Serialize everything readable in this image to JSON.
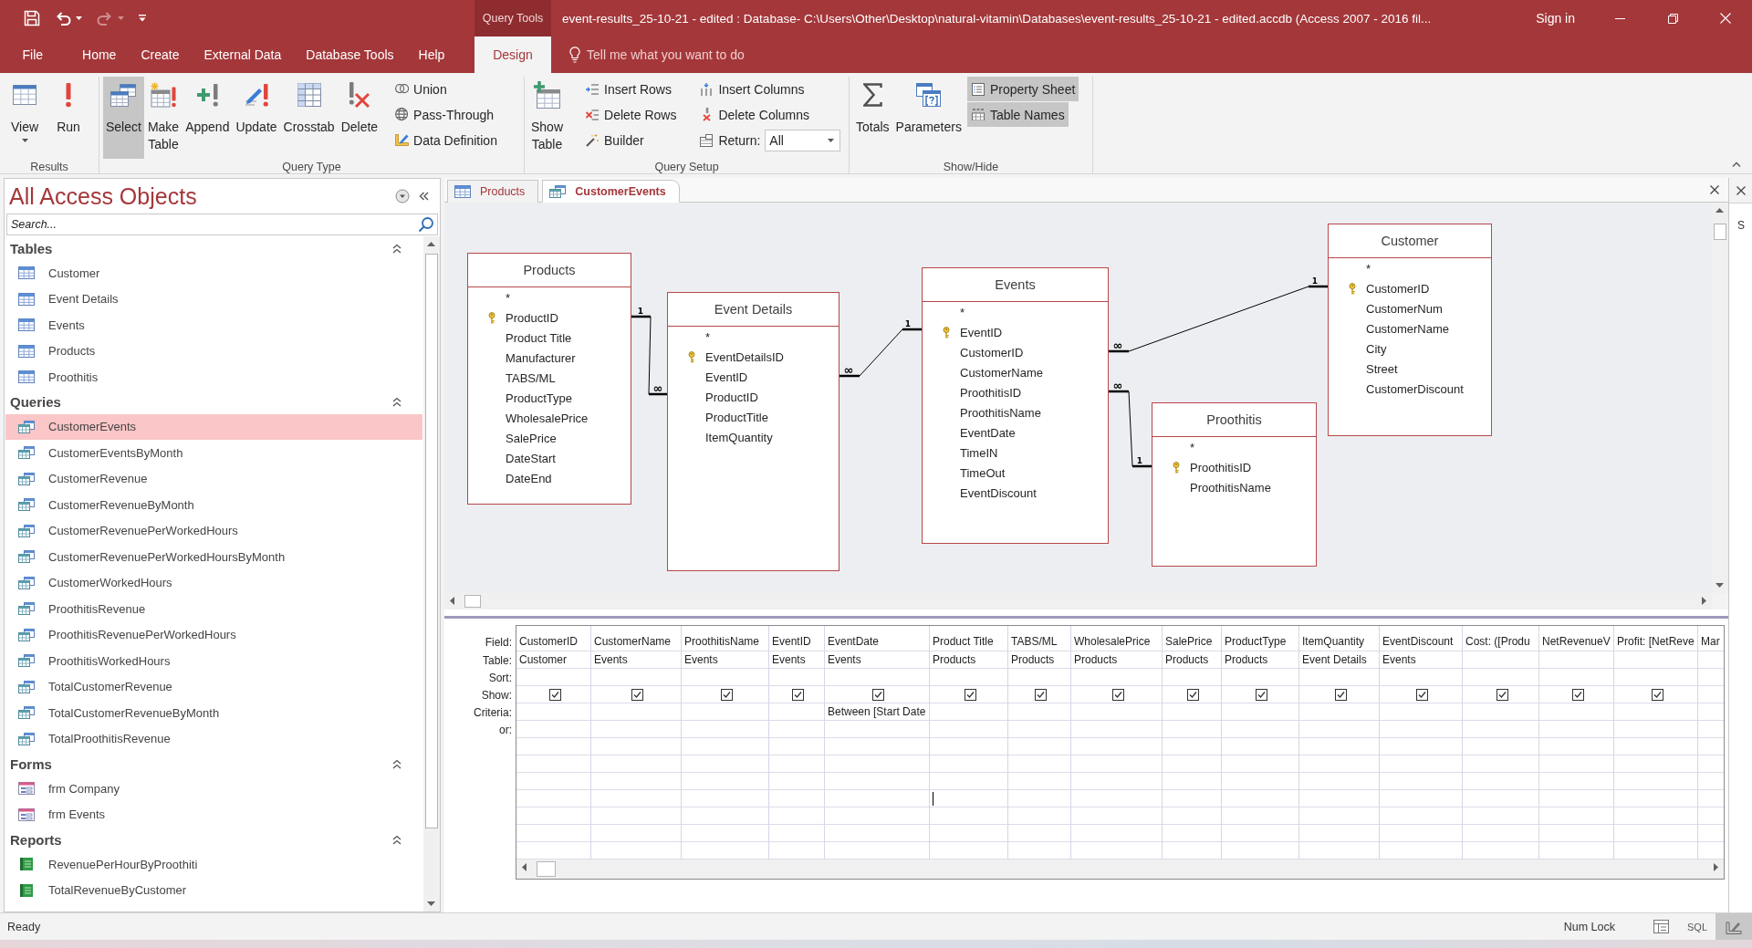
{
  "title_bar": {
    "quick_access": [
      {
        "kind": "save",
        "disabled": false
      },
      {
        "kind": "undo",
        "disabled": false
      },
      {
        "kind": "redo",
        "disabled": true
      },
      {
        "kind": "customize",
        "disabled": false
      }
    ],
    "title": "event-results_25-10-21 - edited : Database- C:\\Users\\Other\\Desktop\\natural-vitamin\\Databases\\event-results_25-10-21 - edited.accdb (Access 2007 - 2016 fil...",
    "sign_in": "Sign in"
  },
  "ribbon_tabs": [
    {
      "label": "File",
      "selected": false
    },
    {
      "label": "Home",
      "selected": false
    },
    {
      "label": "Create",
      "selected": false
    },
    {
      "label": "External Data",
      "selected": false
    },
    {
      "label": "Database Tools",
      "selected": false
    },
    {
      "label": "Help",
      "selected": false
    }
  ],
  "contextual_tabs": {
    "header": "Query Tools",
    "tabs": [
      {
        "label": "Design",
        "selected": true
      }
    ]
  },
  "tell_me": {
    "placeholder": "Tell me what you want to do"
  },
  "ribbon_groups": [
    {
      "label": "Results",
      "large_buttons": [
        {
          "kind": "view",
          "label": "View",
          "dropdown": true
        },
        {
          "kind": "run",
          "label": "Run"
        }
      ]
    },
    {
      "label": "Query Type",
      "large_buttons": [
        {
          "kind": "select",
          "label": "Select",
          "selected": true
        },
        {
          "kind": "make_table",
          "label": "Make Table",
          "selected": false
        },
        {
          "kind": "append",
          "label": "Append",
          "selected": false
        },
        {
          "kind": "update",
          "label": "Update",
          "selected": false
        },
        {
          "kind": "crosstab",
          "label": "Crosstab",
          "selected": false
        },
        {
          "kind": "delete",
          "label": "Delete",
          "selected": false
        }
      ],
      "small_columns": [
        [
          {
            "kind": "union",
            "label": "Union",
            "selected": false
          },
          {
            "kind": "pass_through",
            "label": "Pass-Through",
            "selected": false
          },
          {
            "kind": "data_definition",
            "label": "Data Definition",
            "selected": false
          }
        ]
      ]
    },
    {
      "label": "Query Setup",
      "large_buttons": [
        {
          "kind": "show_table",
          "label": "Show Table"
        }
      ],
      "small_columns": [
        [
          {
            "kind": "insert_rows",
            "label": "Insert Rows"
          },
          {
            "kind": "delete_rows",
            "label": "Delete Rows"
          },
          {
            "kind": "builder",
            "label": "Builder"
          }
        ],
        [
          {
            "kind": "insert_columns",
            "label": "Insert Columns"
          },
          {
            "kind": "delete_columns",
            "label": "Delete Columns"
          },
          {
            "kind": "return",
            "label": "Return:",
            "value": "All"
          }
        ]
      ]
    },
    {
      "label": "Show/Hide",
      "large_buttons": [
        {
          "kind": "totals",
          "label": "Totals",
          "on": false
        },
        {
          "kind": "parameters",
          "label": "Parameters"
        }
      ],
      "small_columns": [
        [
          {
            "kind": "property_sheet",
            "label": "Property Sheet",
            "on": true
          },
          {
            "kind": "table_names",
            "label": "Table Names",
            "on": true
          }
        ]
      ]
    }
  ],
  "nav_pane": {
    "title": "All Access Objects",
    "search": {
      "placeholder": "Search..."
    },
    "groups": [
      {
        "label": "Tables",
        "kind": "table",
        "expanded": true,
        "items": [
          {
            "label": "Customer",
            "selected": false
          },
          {
            "label": "Event Details",
            "selected": false
          },
          {
            "label": "Events",
            "selected": false
          },
          {
            "label": "Products",
            "selected": false
          },
          {
            "label": "Proothitis",
            "selected": false
          }
        ]
      },
      {
        "label": "Queries",
        "kind": "query",
        "expanded": true,
        "items": [
          {
            "label": "CustomerEvents",
            "selected": true
          },
          {
            "label": "CustomerEventsByMonth",
            "selected": false
          },
          {
            "label": "CustomerRevenue",
            "selected": false
          },
          {
            "label": "CustomerRevenueByMonth",
            "selected": false
          },
          {
            "label": "CustomerRevenuePerWorkedHours",
            "selected": false
          },
          {
            "label": "CustomerRevenuePerWorkedHoursByMonth",
            "selected": false
          },
          {
            "label": "CustomerWorkedHours",
            "selected": false
          },
          {
            "label": "ProothitisRevenue",
            "selected": false
          },
          {
            "label": "ProothitisRevenuePerWorkedHours",
            "selected": false
          },
          {
            "label": "ProothitisWorkedHours",
            "selected": false
          },
          {
            "label": "TotalCustomerRevenue",
            "selected": false
          },
          {
            "label": "TotalCustomerRevenueByMonth",
            "selected": false
          },
          {
            "label": "TotalProothitisRevenue",
            "selected": false
          }
        ]
      },
      {
        "label": "Forms",
        "kind": "form",
        "expanded": true,
        "items": [
          {
            "label": "frm Company",
            "selected": false
          },
          {
            "label": "frm Events",
            "selected": false
          }
        ]
      },
      {
        "label": "Reports",
        "kind": "report",
        "expanded": true,
        "items": [
          {
            "label": "RevenuePerHourByProothiti",
            "selected": false
          },
          {
            "label": "TotalRevenueByCustomer",
            "selected": false
          }
        ]
      }
    ]
  },
  "document_tabs": [
    {
      "label": "Products",
      "kind": "table",
      "selected": false
    },
    {
      "label": "CustomerEvents",
      "kind": "query",
      "selected": true
    }
  ],
  "diagram": {
    "tables": [
      {
        "name": "Products",
        "fields": [
          {
            "name": "*",
            "primary_key": false
          },
          {
            "name": "ProductID",
            "primary_key": true
          },
          {
            "name": "Product Title",
            "primary_key": false
          },
          {
            "name": "Manufacturer",
            "primary_key": false
          },
          {
            "name": "TABS/ML",
            "primary_key": false
          },
          {
            "name": "ProductType",
            "primary_key": false
          },
          {
            "name": "WholesalePrice",
            "primary_key": false
          },
          {
            "name": "SalePrice",
            "primary_key": false
          },
          {
            "name": "DateStart",
            "primary_key": false
          },
          {
            "name": "DateEnd",
            "primary_key": false
          }
        ]
      },
      {
        "name": "Event Details",
        "fields": [
          {
            "name": "*",
            "primary_key": false
          },
          {
            "name": "EventDetailsID",
            "primary_key": true
          },
          {
            "name": "EventID",
            "primary_key": false
          },
          {
            "name": "ProductID",
            "primary_key": false
          },
          {
            "name": "ProductTitle",
            "primary_key": false
          },
          {
            "name": "ItemQuantity",
            "primary_key": false
          }
        ]
      },
      {
        "name": "Events",
        "fields": [
          {
            "name": "*",
            "primary_key": false
          },
          {
            "name": "EventID",
            "primary_key": true
          },
          {
            "name": "CustomerID",
            "primary_key": false
          },
          {
            "name": "CustomerName",
            "primary_key": false
          },
          {
            "name": "ProothitisID",
            "primary_key": false
          },
          {
            "name": "ProothitisName",
            "primary_key": false
          },
          {
            "name": "EventDate",
            "primary_key": false
          },
          {
            "name": "TimeIN",
            "primary_key": false
          },
          {
            "name": "TimeOut",
            "primary_key": false
          },
          {
            "name": "EventDiscount",
            "primary_key": false
          }
        ]
      },
      {
        "name": "Customer",
        "fields": [
          {
            "name": "*",
            "primary_key": false
          },
          {
            "name": "CustomerID",
            "primary_key": true
          },
          {
            "name": "CustomerNum",
            "primary_key": false
          },
          {
            "name": "CustomerName",
            "primary_key": false
          },
          {
            "name": "City",
            "primary_key": false
          },
          {
            "name": "Street",
            "primary_key": false
          },
          {
            "name": "CustomerDiscount",
            "primary_key": false
          }
        ]
      },
      {
        "name": "Proothitis",
        "fields": [
          {
            "name": "*",
            "primary_key": false
          },
          {
            "name": "ProothitisID",
            "primary_key": true
          },
          {
            "name": "ProothitisName",
            "primary_key": false
          }
        ]
      }
    ],
    "relationships": [
      {
        "one": "1",
        "many": "∞"
      },
      {
        "one": "1",
        "many": "∞"
      },
      {
        "one": "1",
        "many": "∞"
      },
      {
        "one": "1",
        "many": "∞"
      }
    ]
  },
  "query_grid": {
    "row_labels": [
      "Field:",
      "Table:",
      "Sort:",
      "Show:",
      "Criteria:",
      "or:"
    ],
    "columns": [
      {
        "field": "CustomerID",
        "table": "Customer",
        "show": true,
        "caret": false
      },
      {
        "field": "CustomerName",
        "table": "Events",
        "show": true,
        "caret": false
      },
      {
        "field": "ProothitisName",
        "table": "Events",
        "show": true,
        "caret": false
      },
      {
        "field": "EventID",
        "table": "Events",
        "show": true,
        "caret": false
      },
      {
        "field": "EventDate",
        "table": "Events",
        "show": true,
        "criteria": "Between [Start Date",
        "caret": false
      },
      {
        "field": "Product Title",
        "table": "Products",
        "show": true,
        "caret": true
      },
      {
        "field": "TABS/ML",
        "table": "Products",
        "show": true,
        "caret": false
      },
      {
        "field": "WholesalePrice",
        "table": "Products",
        "show": true,
        "caret": false
      },
      {
        "field": "SalePrice",
        "table": "Products",
        "show": true,
        "caret": false
      },
      {
        "field": "ProductType",
        "table": "Products",
        "show": true,
        "caret": false
      },
      {
        "field": "ItemQuantity",
        "table": "Event Details",
        "show": true,
        "caret": false
      },
      {
        "field": "EventDiscount",
        "table": "Events",
        "show": true,
        "caret": false
      },
      {
        "field": "Cost: ([Produ",
        "show": true,
        "caret": false
      },
      {
        "field": "NetRevenueV",
        "show": true,
        "caret": false
      },
      {
        "field": "Profit: [NetReve",
        "show": true,
        "caret": false
      },
      {
        "field": "Mar",
        "caret": false
      }
    ]
  },
  "property_sheet": {
    "label": "S"
  },
  "status_bar": {
    "message": "Ready",
    "indicators": [
      "Num Lock"
    ],
    "view_buttons": [
      {
        "kind": "datasheet",
        "selected": false
      },
      {
        "kind": "sql",
        "label": "SQL",
        "selected": false
      },
      {
        "kind": "design",
        "selected": true
      }
    ]
  }
}
